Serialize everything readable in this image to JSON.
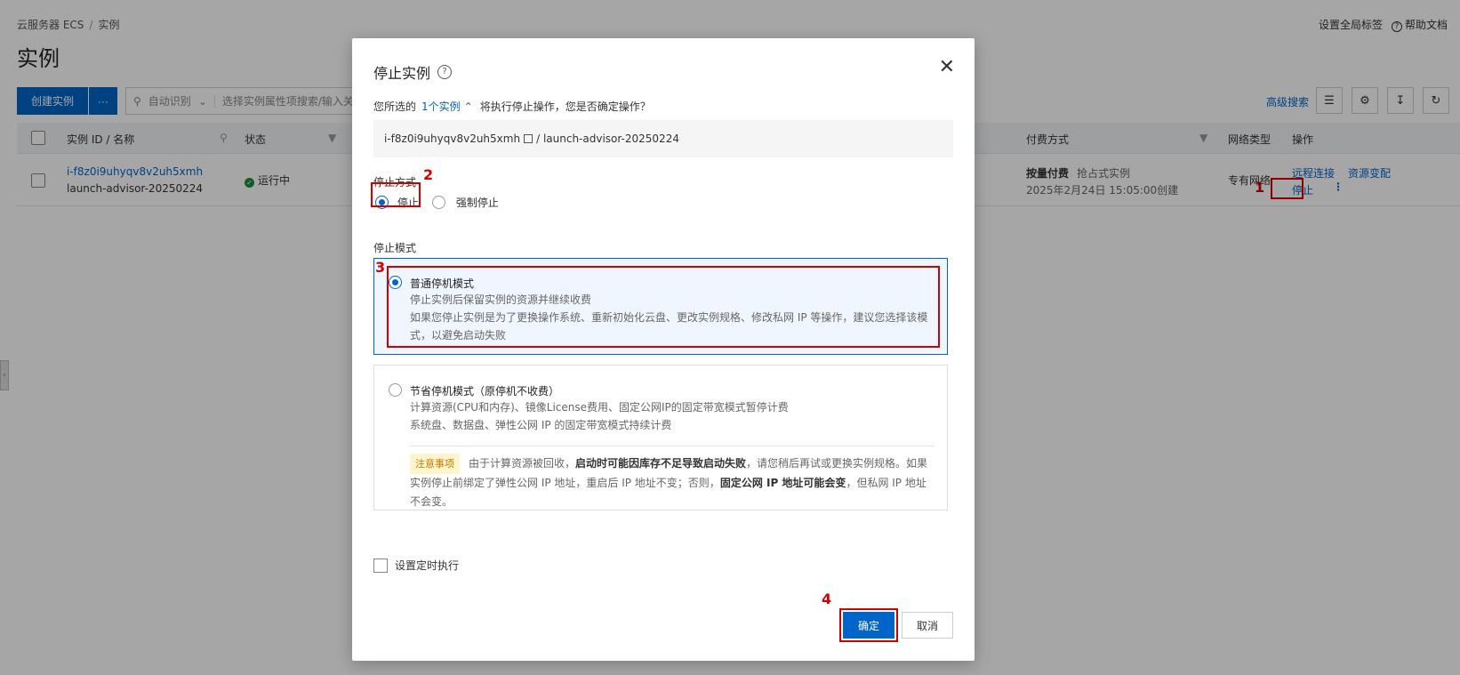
{
  "breadcrumb": {
    "service": "云服务器 ECS",
    "sep": "/",
    "current": "实例"
  },
  "top_links": {
    "global_tags": "设置全局标签",
    "help_docs": "帮助文档"
  },
  "page_title": "实例",
  "toolbar": {
    "create_label": "创建实例",
    "more_label": "···",
    "search_prefix": "自动识别",
    "search_placeholder": "选择实例属性项搜索/输入关",
    "advanced_search": "高级搜索"
  },
  "table": {
    "headers": {
      "id_name": "实例 ID / 名称",
      "status": "状态",
      "billing": "付费方式",
      "network": "网络类型",
      "actions": "操作"
    },
    "row": {
      "id": "i-f8z0i9uhyqv8v2uh5xmh",
      "name": "launch-advisor-20250224",
      "status": "运行中",
      "billing": "按量付费",
      "billing_sub": "抢占式实例",
      "created": "2025年2月24日 15:05:00创建",
      "network": "专有网络",
      "action_remote": "远程连接",
      "action_resource": "资源变配",
      "action_stop": "停止"
    }
  },
  "modal": {
    "title": "停止实例",
    "question_prefix": "您所选的",
    "instance_count": "1个实例",
    "question_suffix": "将执行停止操作，您是否确定操作？",
    "instance_id": "i-f8z0i9uhyqv8v2uh5xmh",
    "instance_sep": "/",
    "instance_name": "launch-advisor-20250224",
    "stop_method_label": "停止方式",
    "stop_options": [
      "停止",
      "强制停止"
    ],
    "stop_mode_label": "停止模式",
    "mode_normal": {
      "title": "普通停机模式",
      "desc1": "停止实例后保留实例的资源并继续收费",
      "desc2": "如果您停止实例是为了更换操作系统、重新初始化云盘、更改实例规格、修改私网 IP 等操作，建议您选择该模",
      "desc3": "式，以避免启动失败"
    },
    "mode_saving": {
      "title": "节省停机模式（原停机不收费）",
      "desc1": "计算资源(CPU和内存)、镜像License费用、固定公网IP的固定带宽模式暂停计费",
      "desc2": "系统盘、数据盘、弹性公网 IP 的固定带宽模式持续计费",
      "notice_tag": "注意事项",
      "notice_a": "由于计算资源被回收，",
      "notice_b": "启动时可能因库存不足导致启动失败",
      "notice_c": "，请您稍后再试或更换实例规格。如果实例停止前绑定了弹性公网 IP 地址，重启后 IP 地址不变；否则，",
      "notice_d": "固定公网 IP 地址可能会变",
      "notice_e": "，但私网 IP 地址不会变。"
    },
    "schedule_label": "设置定时执行",
    "ok_label": "确定",
    "cancel_label": "取消"
  },
  "annotations": [
    "1",
    "2",
    "3",
    "4"
  ]
}
